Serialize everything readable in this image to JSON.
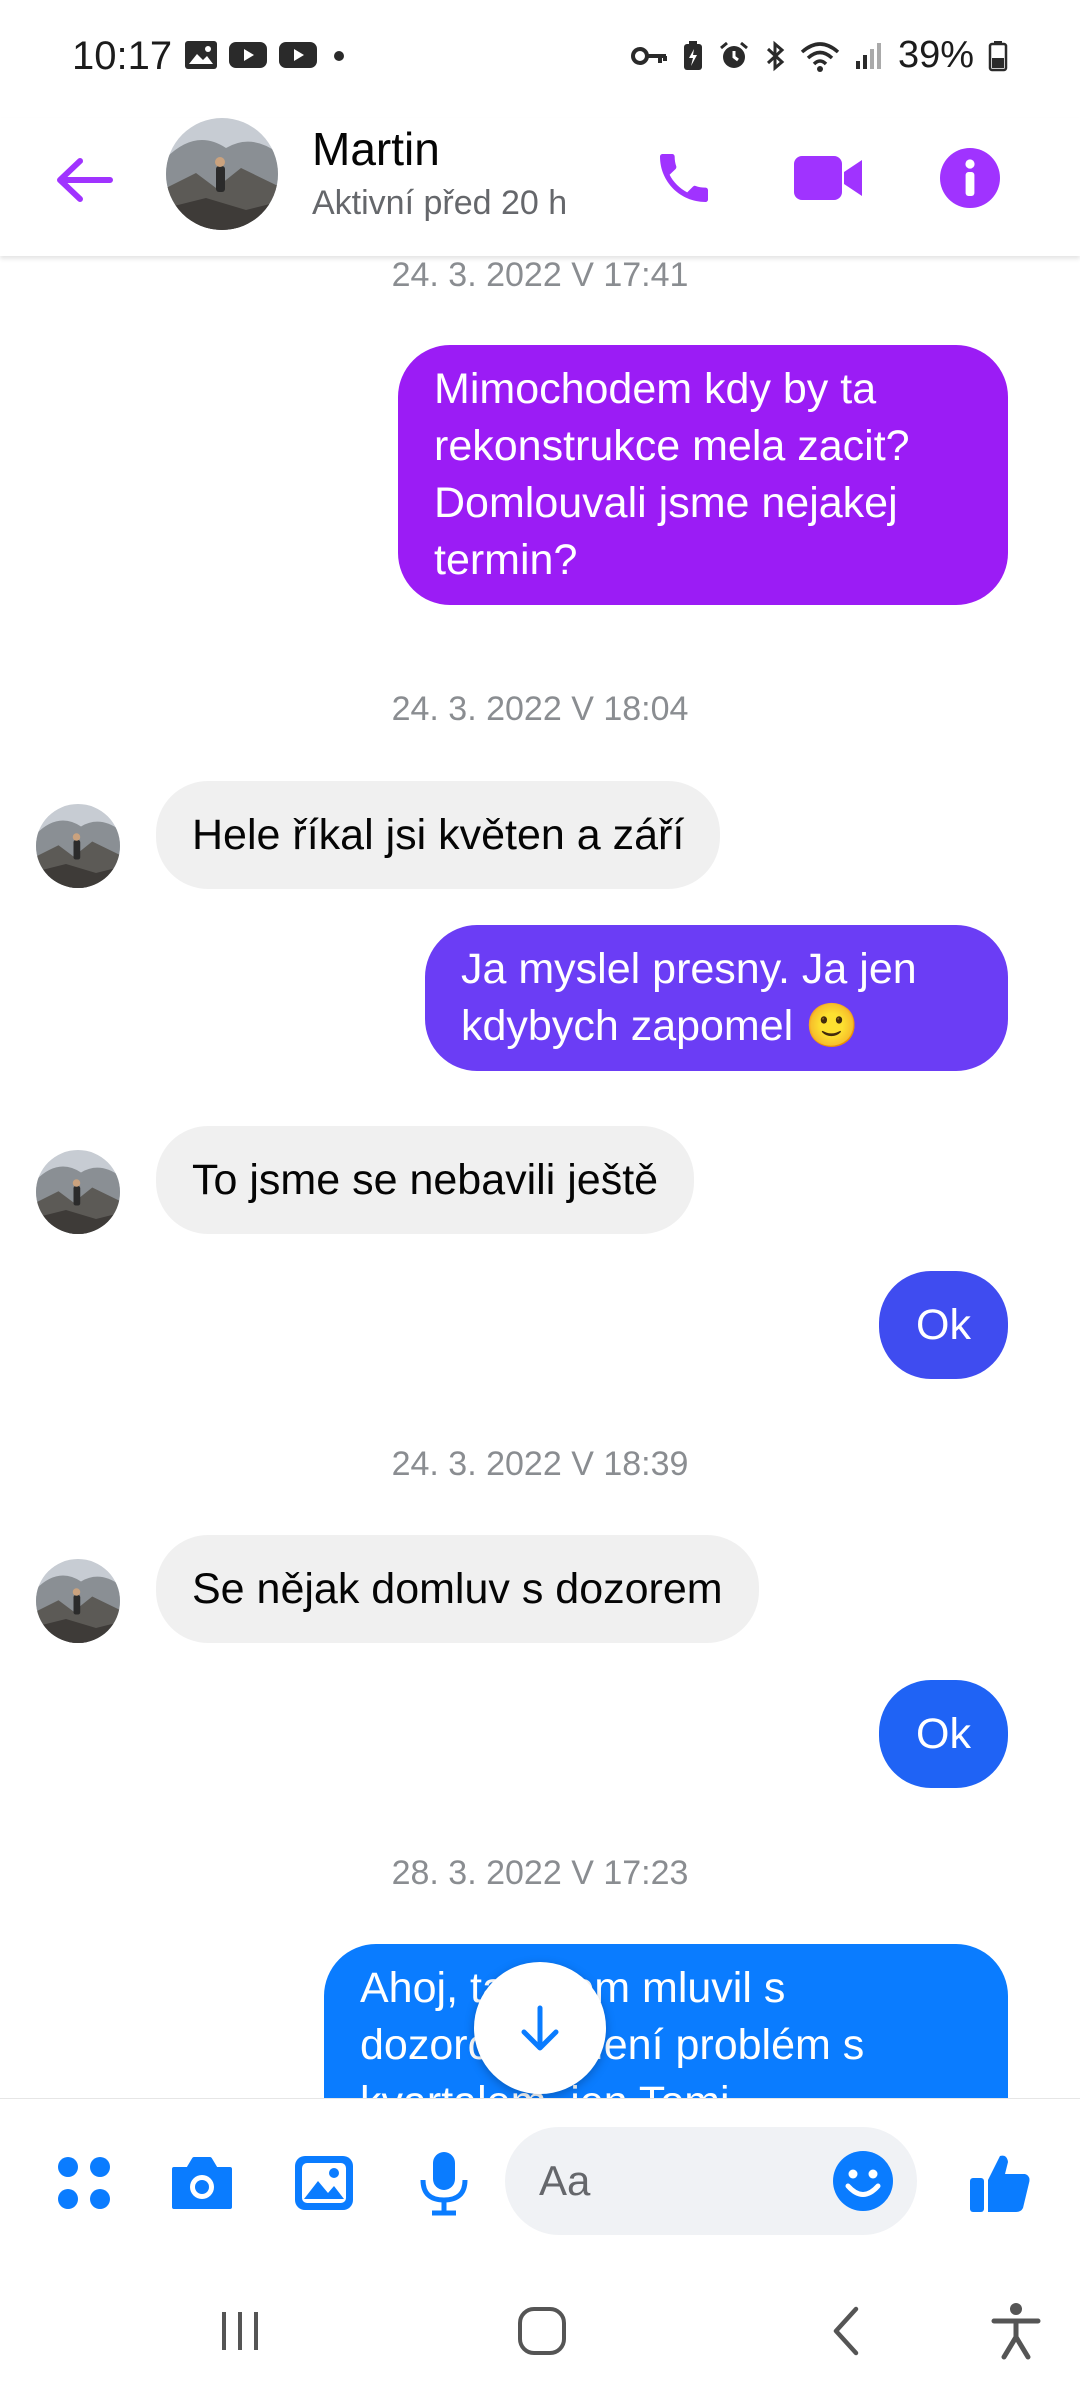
{
  "status_bar": {
    "time": "10:17",
    "battery": "39%"
  },
  "header": {
    "back_icon": "arrow-left-icon",
    "contact_name": "Martin",
    "contact_status": "Aktivní před 20 h",
    "accent_color": "#a033ff"
  },
  "messages": [
    {
      "type": "timestamp",
      "text": "24. 3. 2022 V 17:41"
    },
    {
      "type": "outgoing",
      "text": "Mimochodem kdy by ta rekonstrukce mela zacit? Domlouvali jsme nejakej termin?",
      "color": "#9b1cf5"
    },
    {
      "type": "timestamp",
      "text": "24. 3. 2022 V 18:04"
    },
    {
      "type": "incoming",
      "text": "Hele říkal jsi květen a září"
    },
    {
      "type": "outgoing",
      "text": "Ja myslel presny. Ja jen kdybych zapomel 🙂",
      "color": "#6b3df5"
    },
    {
      "type": "incoming",
      "text": "To jsme se nebavili ještě"
    },
    {
      "type": "outgoing",
      "text": "Ok",
      "color": "#3f4cf0"
    },
    {
      "type": "timestamp",
      "text": "24. 3. 2022 V 18:39"
    },
    {
      "type": "incoming",
      "text": "Se nějak domluv s dozorem"
    },
    {
      "type": "outgoing",
      "text": "Ok",
      "color": "#1f63f5"
    },
    {
      "type": "timestamp",
      "text": "28. 3. 2022 V 17:23"
    },
    {
      "type": "outgoing",
      "text": "Ahoj, tak jsem mluvil s dozorcem. Není problém s kvartalem, jen Tomi",
      "color": "#0a7cff"
    }
  ],
  "composer": {
    "placeholder": "Aa",
    "icons": [
      "apps-icon",
      "camera-icon",
      "gallery-icon",
      "microphone-icon",
      "emoji-icon",
      "thumbs-up-icon"
    ],
    "accent_color": "#0a7cff"
  },
  "navbar": {
    "icons": [
      "recents-icon",
      "home-icon",
      "back-icon",
      "accessibility-icon"
    ]
  }
}
